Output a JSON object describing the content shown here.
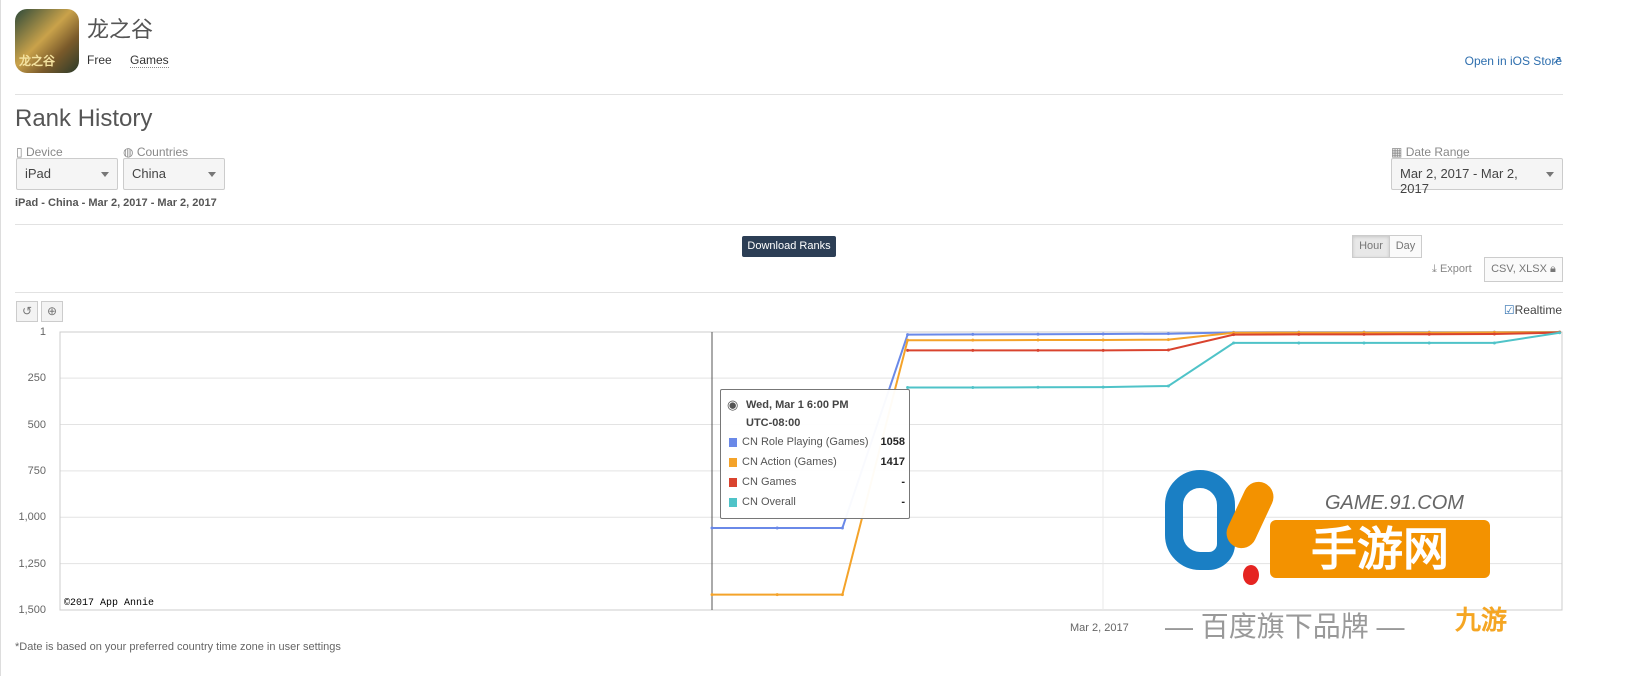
{
  "app": {
    "name": "龙之谷",
    "icon_text": "龙之谷",
    "price": "Free",
    "category": "Games",
    "store_link": "Open in iOS Store"
  },
  "section": {
    "title": "Rank History"
  },
  "filters": {
    "device": {
      "label": "Device",
      "value": "iPad"
    },
    "countries": {
      "label": "Countries",
      "value": "China"
    },
    "date_range": {
      "label": "Date Range",
      "value": "Mar 2, 2017 - Mar 2, 2017"
    },
    "summary": "iPad - China - Mar 2, 2017 - Mar 2, 2017"
  },
  "toolbar": {
    "download": "Download Ranks",
    "hour": "Hour",
    "day": "Day",
    "active_granularity": "Hour",
    "export_label": "Export",
    "export_formats": "CSV, XLSX",
    "realtime_label": "Realtime",
    "realtime_checked": true,
    "reset_icon": "undo-icon",
    "zoom_icon": "zoom-in-icon"
  },
  "chart_data": {
    "type": "line",
    "y_inverted": true,
    "ylim": [
      1,
      1500
    ],
    "yticks": [
      "1",
      "250",
      "500",
      "750",
      "1,000",
      "1,250",
      "1,500"
    ],
    "x_range": [
      "Mar 1 8:00 AM",
      "Mar 2 7:00 AM"
    ],
    "xticks": [
      "Mar 2, 2017"
    ],
    "grid": true,
    "x": [
      "Mar 1 6 PM",
      "Mar 1 7 PM",
      "Mar 1 8 PM",
      "Mar 1 9 PM",
      "Mar 1 10 PM",
      "Mar 1 11 PM",
      "Mar 2 12 AM",
      "Mar 2 1 AM",
      "Mar 2 2 AM",
      "Mar 2 3 AM",
      "Mar 2 4 AM",
      "Mar 2 5 AM",
      "Mar 2 6 AM",
      "Mar 2 7 AM"
    ],
    "series": [
      {
        "name": "CN Role Playing (Games)",
        "color": "#6a89e8",
        "values": [
          1058,
          1058,
          1058,
          15,
          14,
          13,
          12,
          10,
          3,
          2,
          2,
          2,
          2,
          1
        ]
      },
      {
        "name": "CN Action (Games)",
        "color": "#f4a32a",
        "values": [
          1417,
          1417,
          1417,
          45,
          45,
          44,
          44,
          42,
          5,
          4,
          4,
          4,
          3,
          2
        ]
      },
      {
        "name": "CN Games",
        "color": "#d9432e",
        "values": [
          null,
          null,
          null,
          100,
          100,
          100,
          100,
          98,
          15,
          14,
          14,
          13,
          12,
          4
        ]
      },
      {
        "name": "CN Overall",
        "color": "#4fc3c8",
        "values": [
          null,
          null,
          null,
          300,
          300,
          299,
          298,
          292,
          60,
          60,
          60,
          60,
          60,
          5
        ]
      }
    ],
    "credit": "©2017 App Annie"
  },
  "tooltip": {
    "time": "Wed, Mar 1 6:00 PM",
    "tz": "UTC-08:00",
    "rows": [
      {
        "name": "CN Role Playing (Games)",
        "value": "1058"
      },
      {
        "name": "CN Action (Games)",
        "value": "1417"
      },
      {
        "name": "CN Games",
        "value": "-"
      },
      {
        "name": "CN Overall",
        "value": "-"
      }
    ]
  },
  "footnote": "*Date is based on your preferred country time zone in user settings",
  "watermark": {
    "domain": "GAME.91.COM",
    "name": "手游网",
    "tagline": "百度旗下品牌",
    "brand2": "九游"
  }
}
